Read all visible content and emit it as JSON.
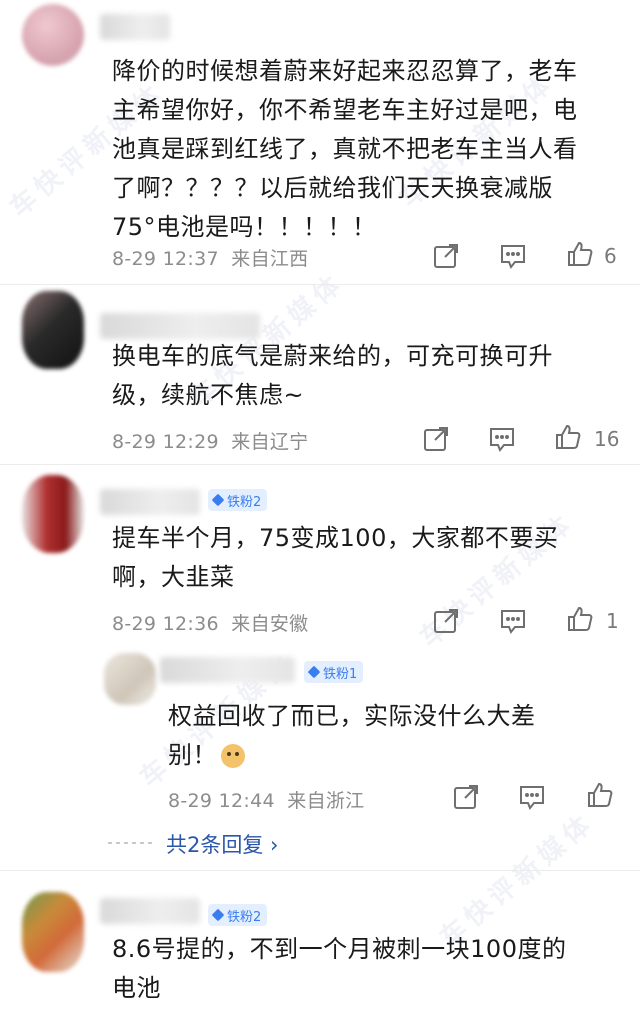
{
  "comments": [
    {
      "text_lines": [
        "降价的时候想着蔚来好起来忍忍算了，老车",
        "主希望你好，你不希望老车主好过是吧，电",
        "池真是踩到红线了，真就不把老车主当人看",
        "了啊？？？？以后就给我们天天换衰减版",
        "75°电池是吗！！！！！"
      ],
      "time": "8-29 12:37",
      "location": "来自江西",
      "likes": "6",
      "avatar_colors": [
        "#e9b8c2",
        "#d4a0ac"
      ]
    },
    {
      "text_lines": [
        "换电车的底气是蔚来给的，可充可换可升",
        "级，续航不焦虑~"
      ],
      "time": "8-29 12:29",
      "location": "来自辽宁",
      "likes": "16",
      "avatar_colors": [
        "#2a2a2a",
        "#6a5a5a"
      ]
    },
    {
      "badge": "铁粉2",
      "text_lines": [
        "提车半个月，75变成100，大家都不要买",
        "啊，大韭菜"
      ],
      "time": "8-29 12:36",
      "location": "来自安徽",
      "likes": "1",
      "avatar_colors": [
        "#a83030",
        "#e4d8d8"
      ]
    },
    {
      "badge": "铁粉1",
      "text_lines": [
        "权益回收了而已，实际没什么大差",
        "别！"
      ],
      "time": "8-29 12:44",
      "location": "来自浙江",
      "likes": "",
      "avatar_colors": [
        "#d8d0c4",
        "#eae6de"
      ]
    },
    {
      "badge": "铁粉2",
      "text_lines": [
        "8.6号提的，不到一个月被刺一块100度的",
        "电池"
      ],
      "avatar_colors": [
        "#c98a3a",
        "#7aa05a"
      ]
    }
  ],
  "more_replies_label": "共2条回复 ›",
  "watermark_text": "车快评新媒体",
  "colors": {
    "link": "#2a56a8",
    "badge_bg": "#e3efff",
    "badge_fg": "#3a7df0",
    "meta": "#8c8c8c"
  },
  "icons": [
    "share-icon",
    "comment-icon",
    "like-icon",
    "emoji-doge-icon"
  ]
}
